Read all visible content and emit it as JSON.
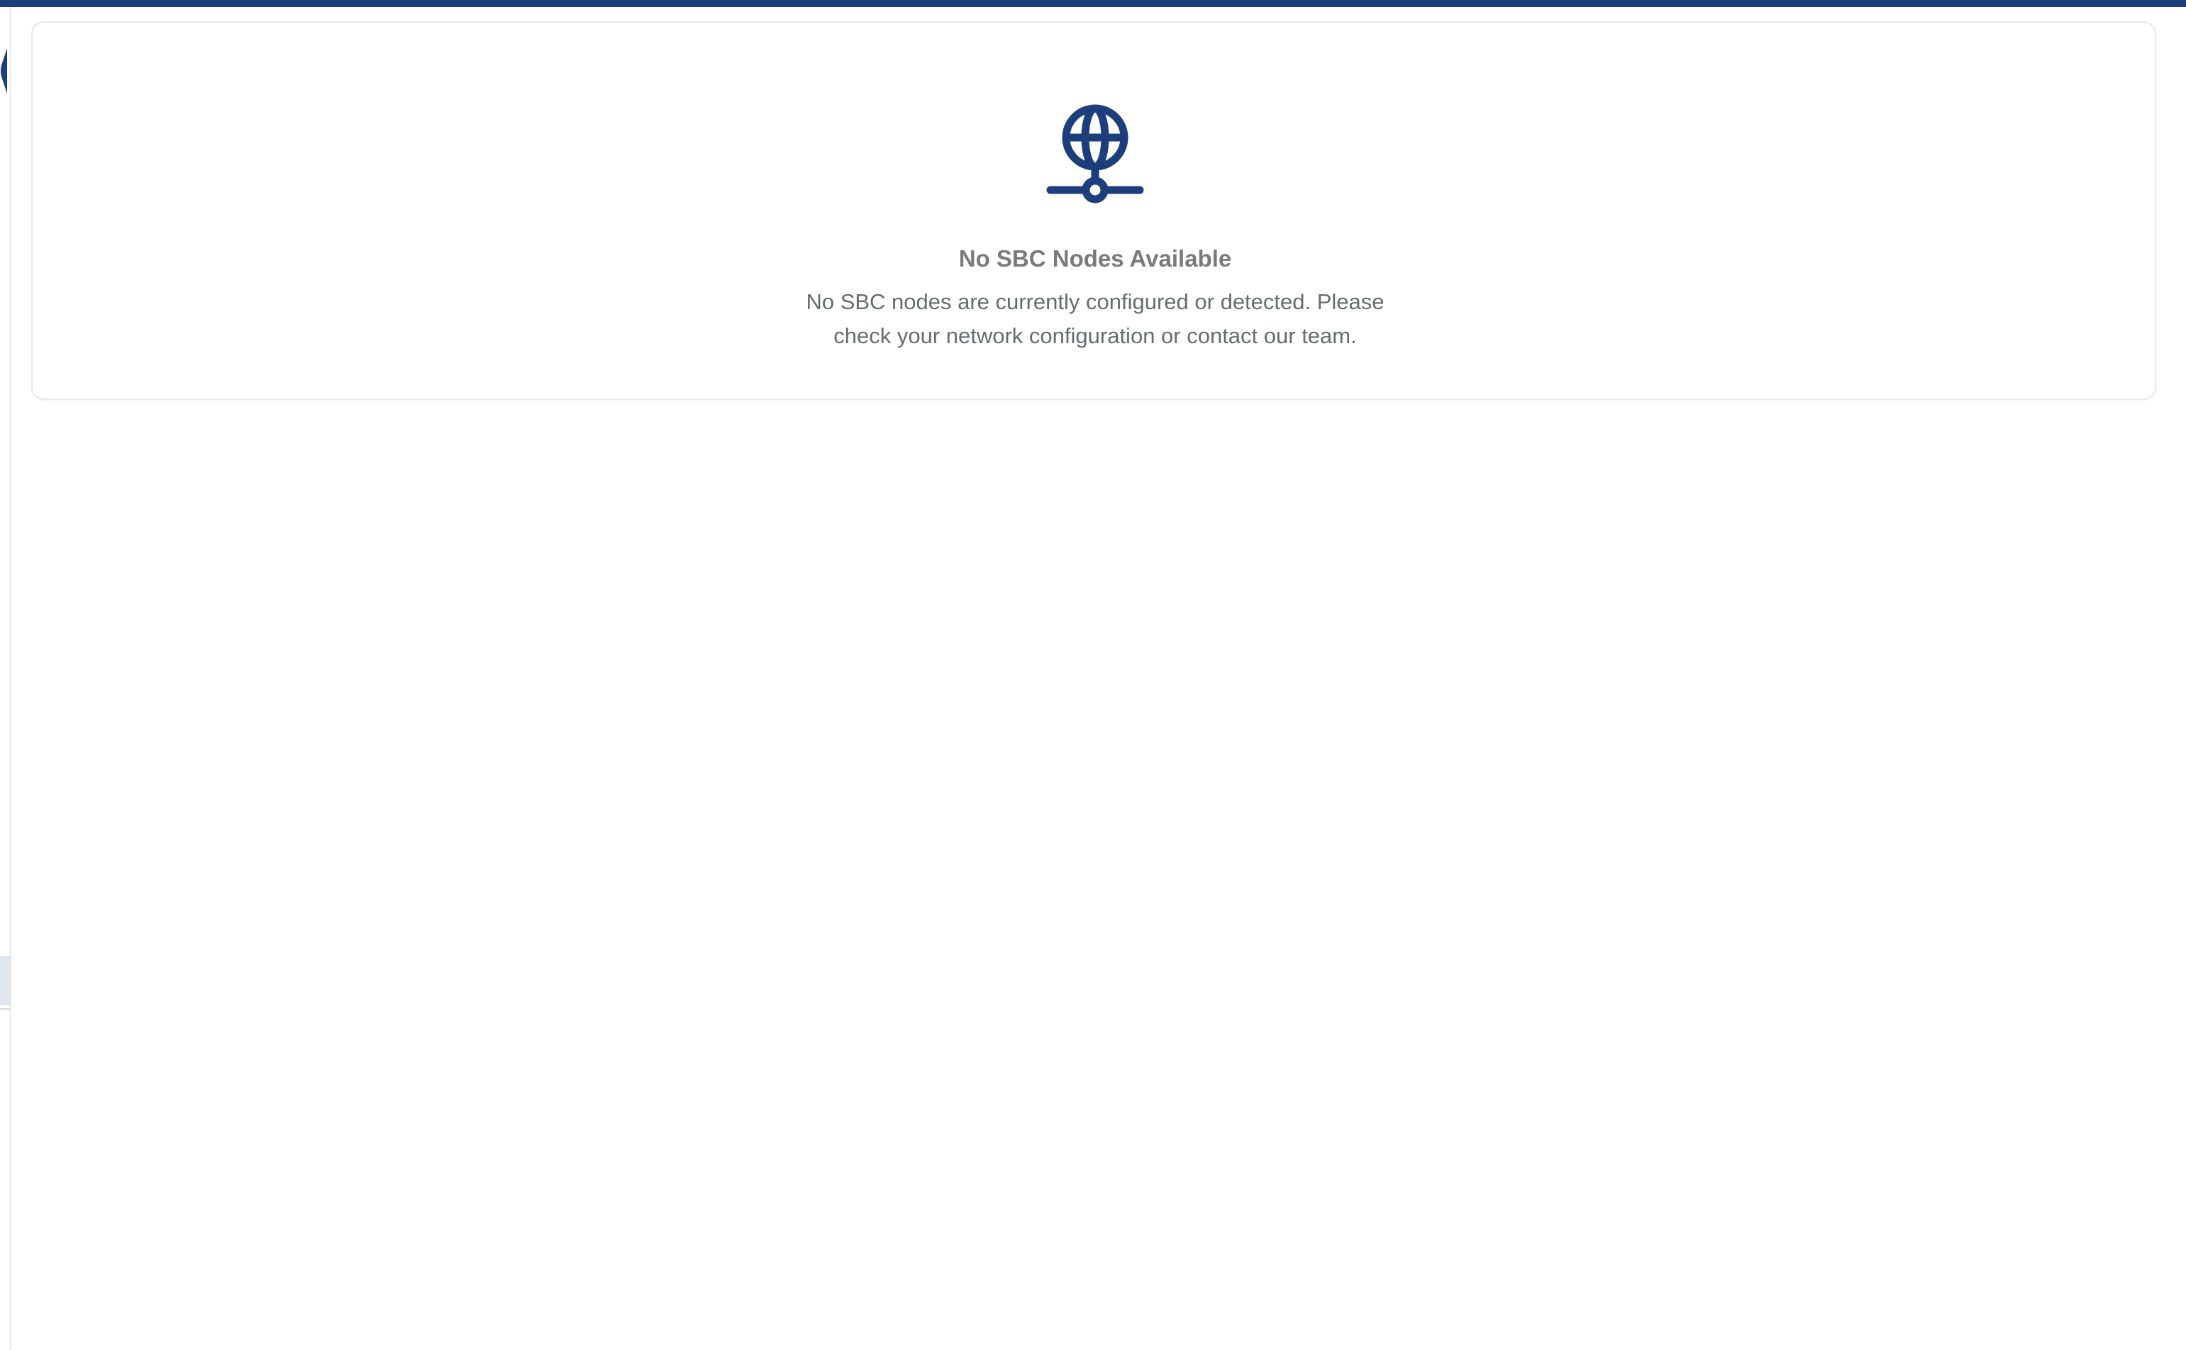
{
  "empty_state": {
    "icon": "network-globe-icon",
    "title": "No SBC Nodes Available",
    "description": "No SBC nodes are currently configured or detected. Please check your network configuration or contact our team."
  },
  "colors": {
    "accent": "#1d3e7c",
    "title_text": "#7a7a7a",
    "description_text": "#666b72",
    "card_border": "#e6e8eb"
  }
}
